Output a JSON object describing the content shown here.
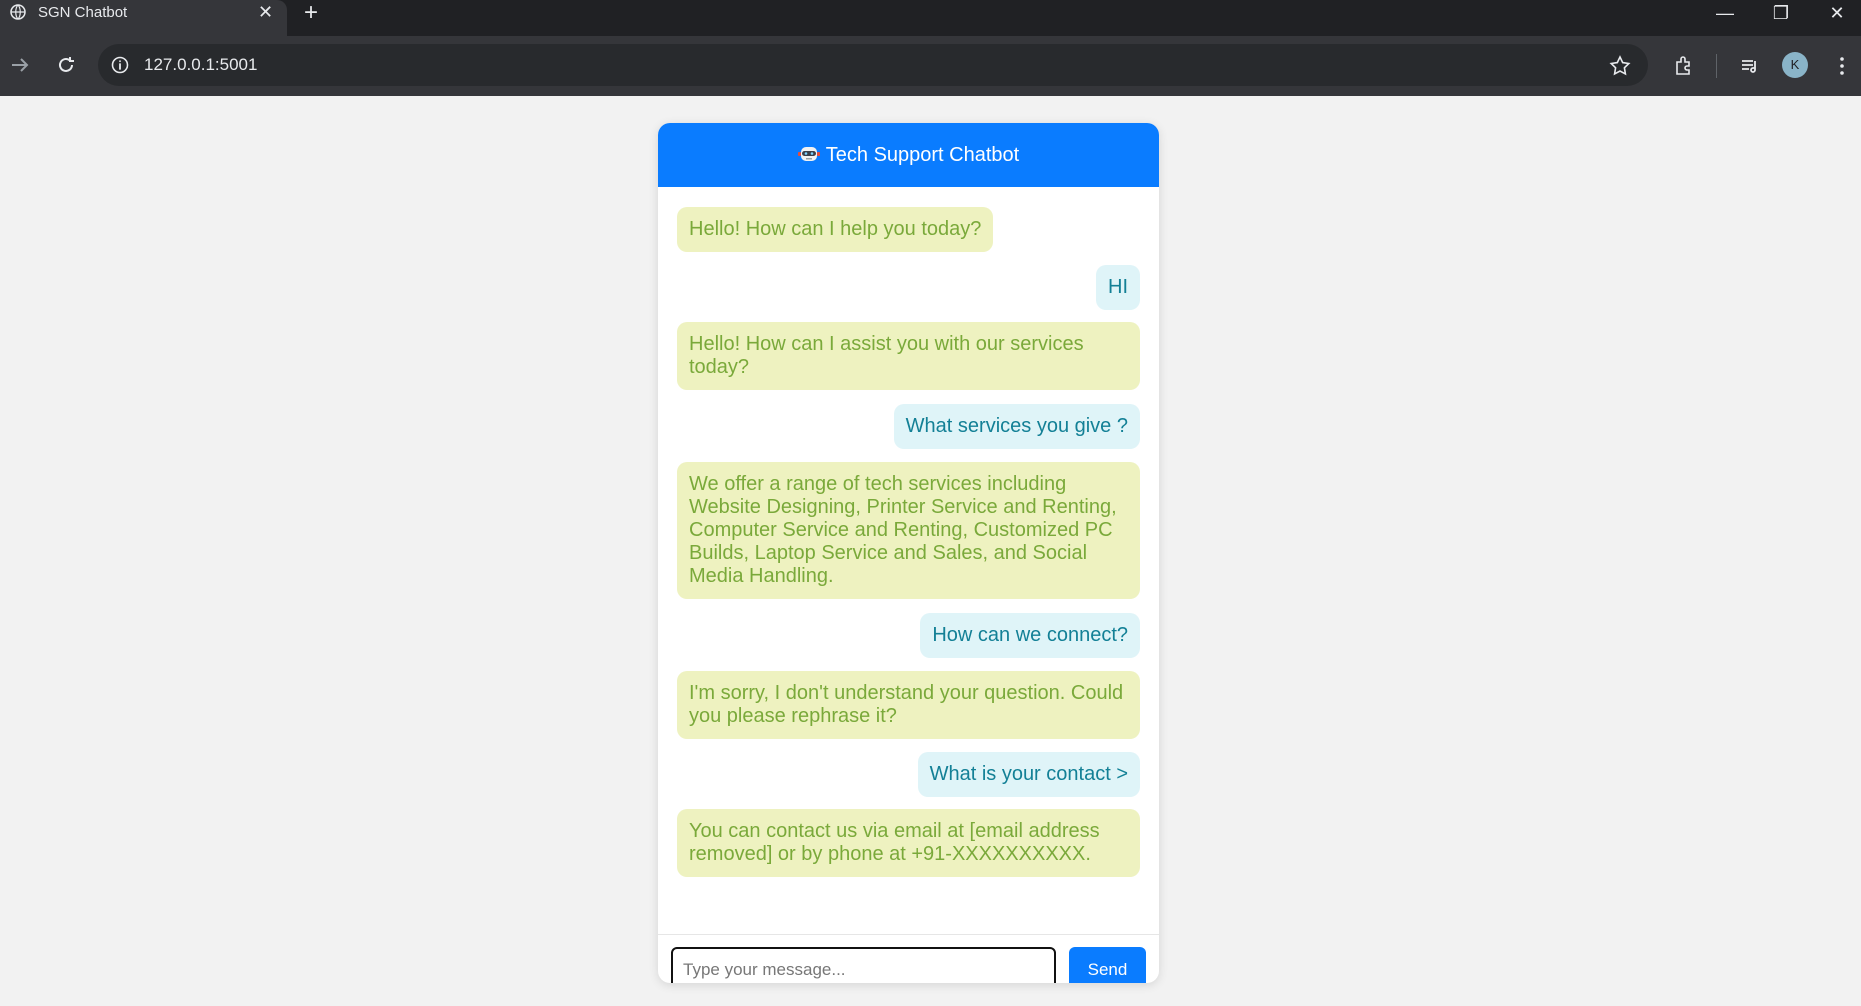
{
  "browser": {
    "tab_title": "SGN Chatbot",
    "tab_close": "✕",
    "new_tab": "+",
    "url": "127.0.0.1:5001",
    "avatar_letter": "K",
    "window_controls": [
      "—",
      "❐",
      "✕"
    ]
  },
  "chat": {
    "header_title": "Tech Support Chatbot",
    "messages": [
      {
        "sender": "bot",
        "text": "Hello! How can I help you today?"
      },
      {
        "sender": "user",
        "text": "HI"
      },
      {
        "sender": "bot",
        "text": "Hello! How can I assist you with our services today?"
      },
      {
        "sender": "user",
        "text": "What services you give ?"
      },
      {
        "sender": "bot",
        "text": "We offer a range of tech services including Website Designing, Printer Service and Renting, Computer Service and Renting, Customized PC Builds, Laptop Service and Sales, and Social Media Handling."
      },
      {
        "sender": "user",
        "text": "How can we connect?"
      },
      {
        "sender": "bot",
        "text": "I'm sorry, I don't understand your question. Could you please rephrase it?"
      },
      {
        "sender": "user",
        "text": "What is your contact >"
      },
      {
        "sender": "bot",
        "text": "You can contact us via email at [email address removed] or by phone at +91-XXXXXXXXXX."
      }
    ],
    "input_placeholder": "Type your message...",
    "input_value": "",
    "send_label": "Send"
  },
  "colors": {
    "header_bg": "#0a7cff",
    "bot_bubble_bg": "#eef2c0",
    "bot_text": "#7aa93a",
    "user_bubble_bg": "#dff4f8",
    "user_text": "#138096"
  },
  "icons": {
    "tab_favicon": "globe-icon",
    "header_icon": "robot-icon",
    "toolbar": [
      "forward-icon",
      "reload-icon",
      "info-icon",
      "star-icon",
      "extensions-icon",
      "media-icon",
      "menu-icon"
    ]
  }
}
